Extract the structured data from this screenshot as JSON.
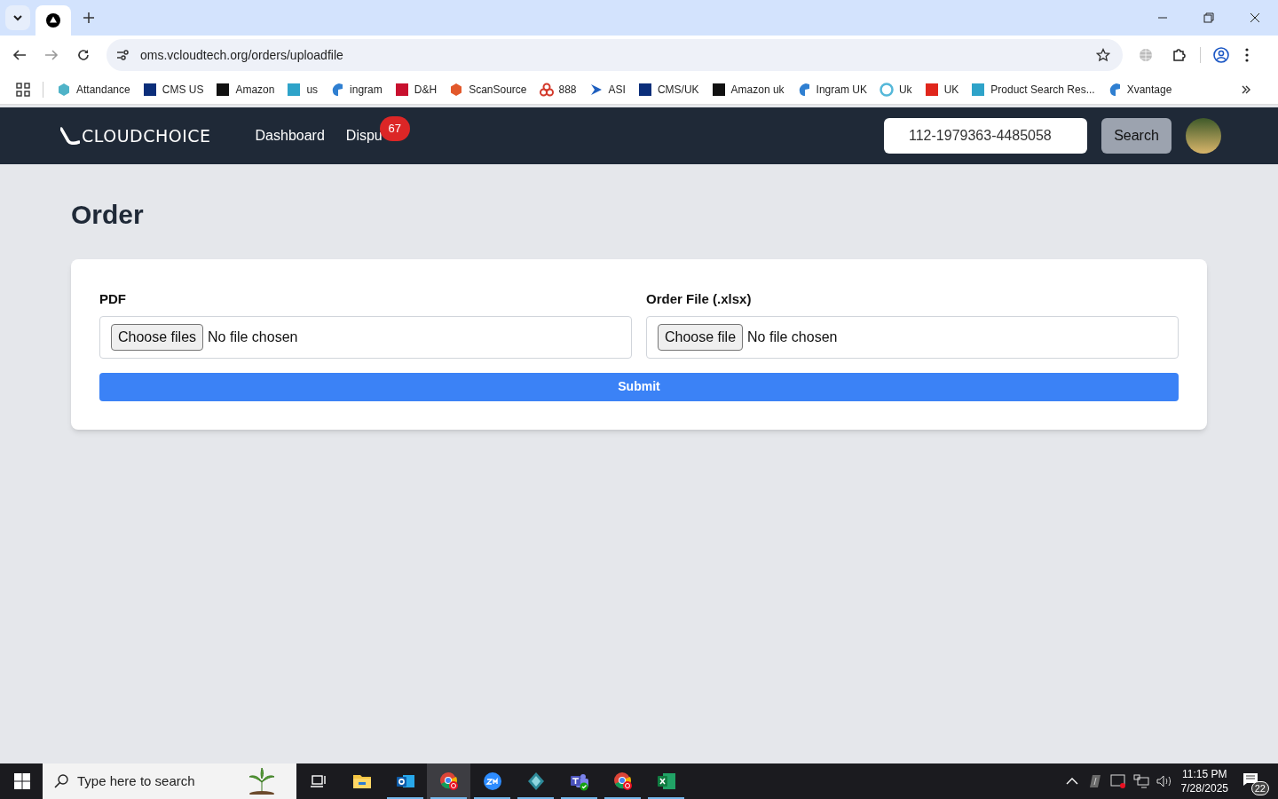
{
  "browser": {
    "tab": {
      "selected": true
    },
    "address": "oms.vcloudtech.org/orders/uploadfile",
    "bookmarks": [
      {
        "label": "Attandance",
        "kind": "hex",
        "color": "#4fb3c8"
      },
      {
        "label": "CMS US",
        "kind": "square",
        "color": "#0b2e7a"
      },
      {
        "label": "Amazon",
        "kind": "square",
        "color": "#111111"
      },
      {
        "label": "us",
        "kind": "square",
        "color": "#2ea3c9"
      },
      {
        "label": "ingram",
        "kind": "drop",
        "color": "#2f7fd1"
      },
      {
        "label": "D&H",
        "kind": "square",
        "color": "#c8102e"
      },
      {
        "label": "ScanSource",
        "kind": "hex",
        "color": "#e2582b"
      },
      {
        "label": "888",
        "kind": "rings",
        "color": "#d33a2c"
      },
      {
        "label": "ASI",
        "kind": "play",
        "color": "#1f5fbf"
      },
      {
        "label": "CMS/UK",
        "kind": "square",
        "color": "#0b2e7a"
      },
      {
        "label": "Amazon uk",
        "kind": "square",
        "color": "#111111"
      },
      {
        "label": "Ingram UK",
        "kind": "drop",
        "color": "#2f7fd1"
      },
      {
        "label": "Uk",
        "kind": "ring",
        "color": "#55b8d9"
      },
      {
        "label": "UK",
        "kind": "square",
        "color": "#e0261c"
      },
      {
        "label": "Product Search Res...",
        "kind": "square",
        "color": "#2ea3c9"
      },
      {
        "label": "Xvantage",
        "kind": "drop",
        "color": "#2f7fd1"
      }
    ]
  },
  "navbar": {
    "logo": "CLOUDCHOICE",
    "links": [
      {
        "label": "Dashboard"
      },
      {
        "label": "Dispu",
        "badge": "67"
      }
    ],
    "search": {
      "value": "112-1979363-4485058"
    },
    "search_button": "Search"
  },
  "page": {
    "title": "Order",
    "fields": [
      {
        "label": "PDF",
        "button": "Choose files",
        "status": "No file chosen"
      },
      {
        "label": "Order File (.xlsx)",
        "button": "Choose file",
        "status": "No file chosen"
      }
    ],
    "submit": "Submit"
  },
  "taskbar": {
    "search_placeholder": "Type here to search",
    "apps": [
      {
        "kind": "taskview",
        "selected": false,
        "running": false
      },
      {
        "kind": "folder",
        "selected": false,
        "running": false
      },
      {
        "kind": "mail",
        "selected": false,
        "running": true
      },
      {
        "kind": "browser",
        "selected": true,
        "running": true
      },
      {
        "kind": "video",
        "selected": false,
        "running": true
      },
      {
        "kind": "diamond",
        "selected": false,
        "running": true
      },
      {
        "kind": "chat",
        "selected": false,
        "running": true
      },
      {
        "kind": "browser",
        "selected": false,
        "running": true
      },
      {
        "kind": "sheet",
        "selected": false,
        "running": true
      }
    ],
    "time": "11:15 PM",
    "date": "7/28/2025",
    "notifications": "22"
  }
}
